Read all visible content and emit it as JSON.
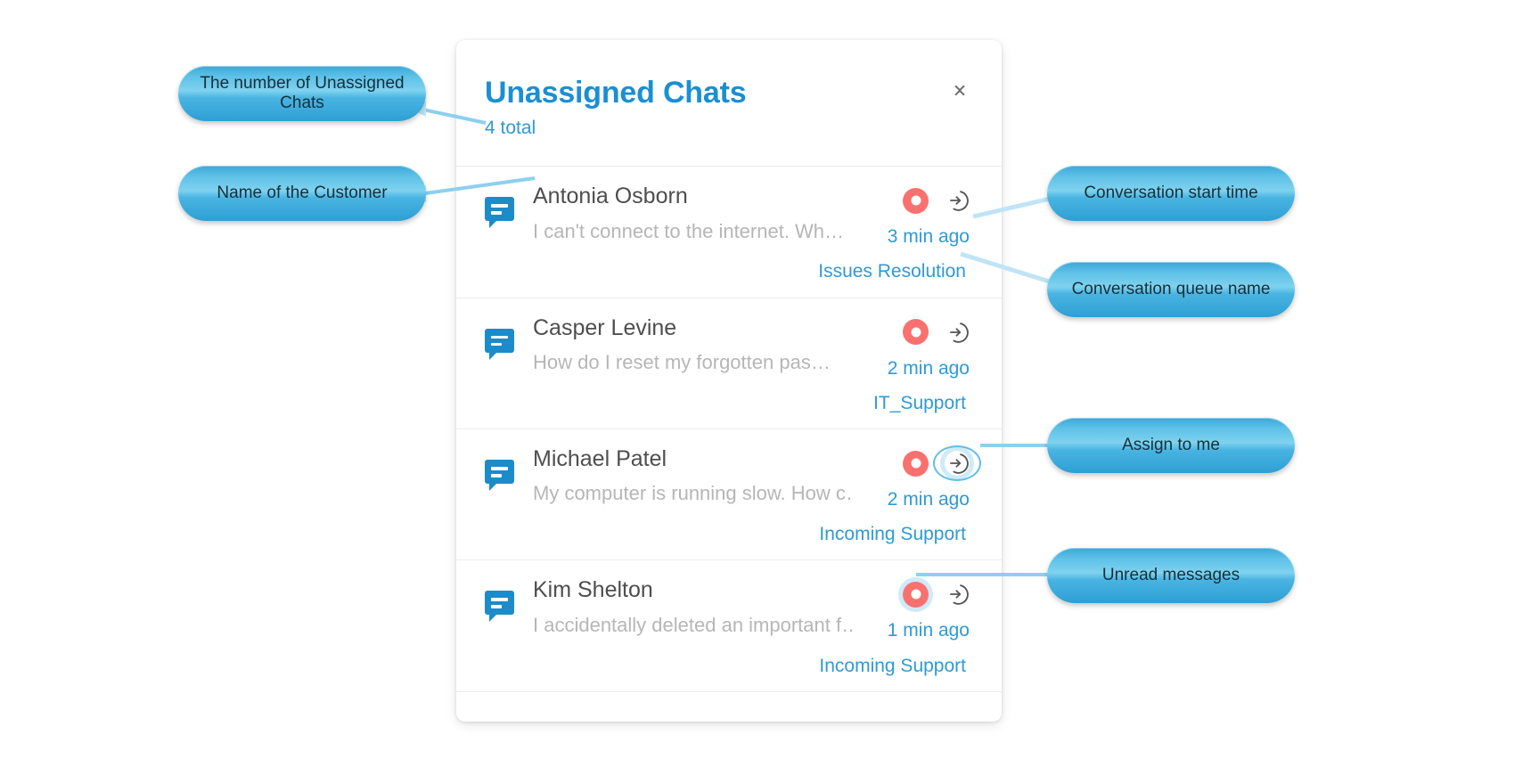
{
  "card": {
    "title": "Unassigned Chats",
    "subtitle": "4 total",
    "collapse_icon": "collapse-icon",
    "accent_color": "#2e9ad6",
    "title_color": "#1a8fd4",
    "unread_color": "#f9716f",
    "highlight_color": "#cfeaf8"
  },
  "chats": [
    {
      "name": "Antonia Osborn",
      "preview": "I can't connect to the internet. Wh…",
      "time": "3 min ago",
      "queue": "Issues Resolution",
      "unread": true,
      "bubble_icon": "chat-bubble-icon",
      "assign_icon": "assign-to-me-icon",
      "unread_highlighted": false,
      "assign_highlighted": false
    },
    {
      "name": "Casper Levine",
      "preview": "How do I reset my forgotten pas…",
      "time": "2 min ago",
      "queue": "IT_Support",
      "unread": true,
      "bubble_icon": "chat-bubble-icon",
      "assign_icon": "assign-to-me-icon",
      "unread_highlighted": false,
      "assign_highlighted": false
    },
    {
      "name": "Michael Patel",
      "preview": "My computer is running slow. How c…",
      "time": "2 min ago",
      "queue": "Incoming Support",
      "unread": true,
      "bubble_icon": "chat-bubble-icon",
      "assign_icon": "assign-to-me-icon",
      "unread_highlighted": false,
      "assign_highlighted": true
    },
    {
      "name": "Kim Shelton",
      "preview": "I accidentally deleted an important f…",
      "time": "1 min ago",
      "queue": "Incoming Support",
      "unread": true,
      "bubble_icon": "chat-bubble-icon",
      "assign_icon": "assign-to-me-icon",
      "unread_highlighted": true,
      "assign_highlighted": false
    }
  ],
  "callouts": [
    {
      "id": "callout-unassigned-count",
      "label": "The number of Unassigned Chats"
    },
    {
      "id": "callout-customer-name",
      "label": "Name of the Customer"
    },
    {
      "id": "callout-start-time",
      "label": "Conversation start time"
    },
    {
      "id": "callout-queue-name",
      "label": "Conversation queue name"
    },
    {
      "id": "callout-assign-to-me",
      "label": "Assign to me"
    },
    {
      "id": "callout-unread-messages",
      "label": "Unread messages"
    }
  ]
}
